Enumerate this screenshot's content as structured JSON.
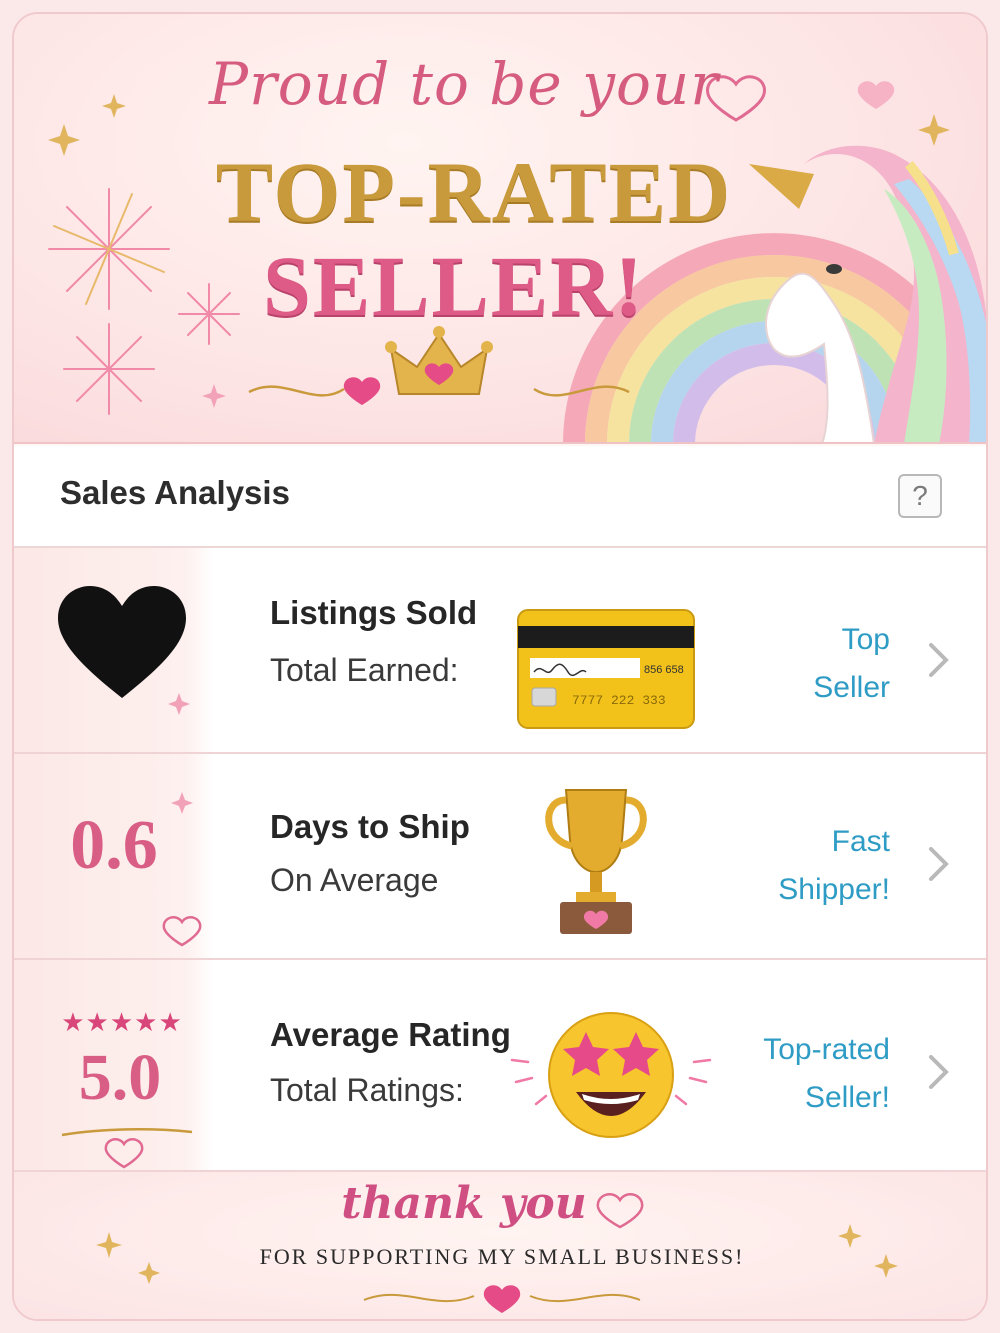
{
  "banner": {
    "line1": "Proud to be your",
    "line2": "TOP-RATED",
    "line3": "SELLER!"
  },
  "section": {
    "title": "Sales Analysis",
    "help_label": "?"
  },
  "rows": [
    {
      "title": "Listings Sold",
      "subtitle": "Total Earned:",
      "badge_line1": "Top",
      "badge_line2": "Seller",
      "card_number_top": "856 658",
      "card_number": "7777  222  333"
    },
    {
      "value": "0.6",
      "title": "Days to Ship",
      "subtitle": "On Average",
      "badge_line1": "Fast",
      "badge_line2": "Shipper!"
    },
    {
      "stars": "★★★★★",
      "value": "5.0",
      "title": "Average Rating",
      "subtitle": "Total Ratings:",
      "badge_line1": "Top-rated",
      "badge_line2": "Seller!"
    }
  ],
  "footer": {
    "thanks": "thank you",
    "support": "FOR SUPPORTING MY SMALL BUSINESS!"
  },
  "colors": {
    "accent_pink": "#d95e86",
    "gold": "#c99a3b",
    "link_blue": "#2f9cc5"
  },
  "icons": [
    "black-heart-icon",
    "credit-card-icon",
    "trophy-icon",
    "star-struck-emoji-icon",
    "chevron-right-icon",
    "crown-icon",
    "unicorn-icon",
    "rainbow-icon",
    "fireworks-icon",
    "sparkle-icon",
    "heart-icon"
  ]
}
